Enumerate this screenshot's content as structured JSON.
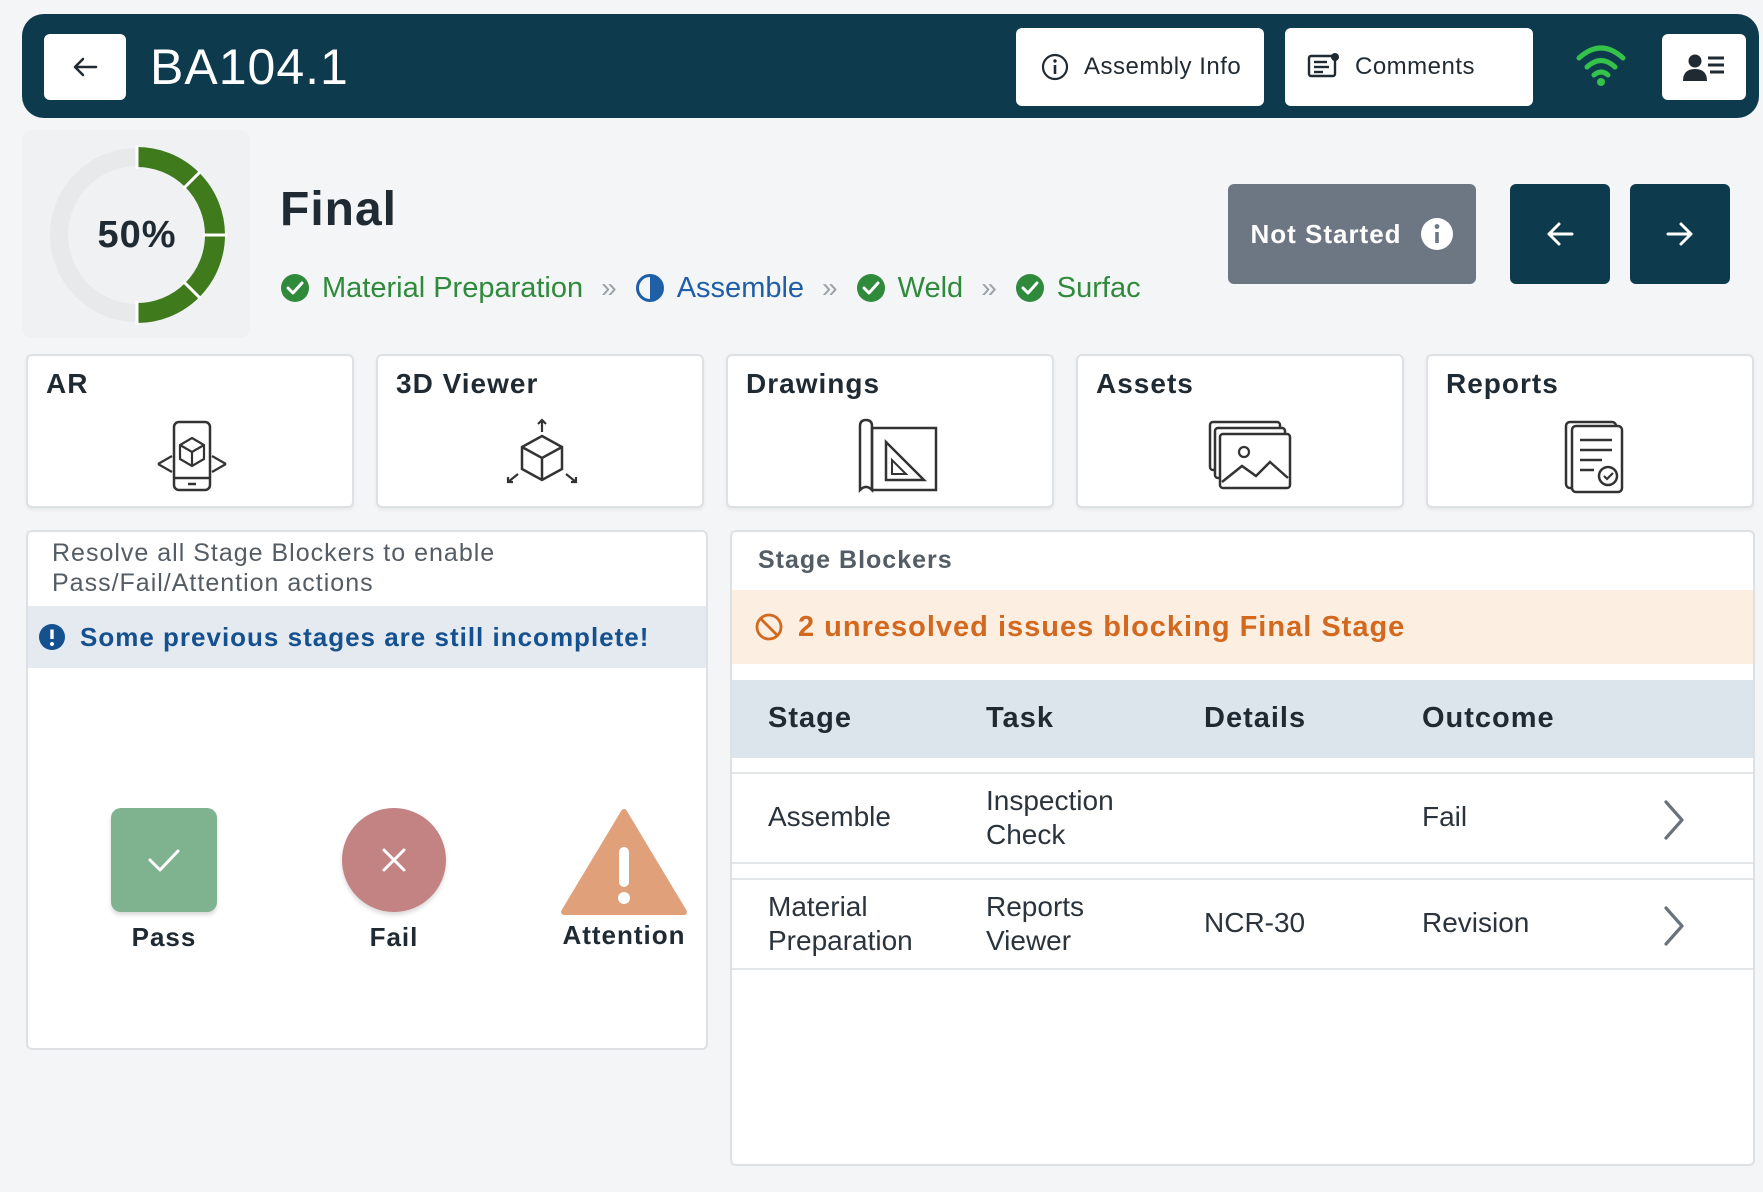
{
  "header": {
    "title": "BA104.1",
    "assembly_info_label": "Assembly Info",
    "comments_label": "Comments"
  },
  "progress": {
    "percent_label": "50%",
    "fraction": 0.5
  },
  "stage": {
    "title": "Final",
    "status": "Not Started",
    "breadcrumb": [
      {
        "label": "Material Preparation",
        "state": "complete"
      },
      {
        "label": "Assemble",
        "state": "in-progress"
      },
      {
        "label": "Weld",
        "state": "complete"
      },
      {
        "label": "Surfac",
        "state": "complete"
      }
    ]
  },
  "tools": [
    {
      "label": "AR",
      "icon": "ar-phone-icon"
    },
    {
      "label": "3D Viewer",
      "icon": "cube-icon"
    },
    {
      "label": "Drawings",
      "icon": "drawing-icon"
    },
    {
      "label": "Assets",
      "icon": "images-icon"
    },
    {
      "label": "Reports",
      "icon": "report-icon"
    }
  ],
  "actions": {
    "hint_line1": "Resolve all Stage Blockers to enable",
    "hint_line2": "Pass/Fail/Attention actions",
    "alert": "Some previous stages are still incomplete!",
    "pass_label": "Pass",
    "fail_label": "Fail",
    "attention_label": "Attention"
  },
  "blockers": {
    "title": "Stage Blockers",
    "alert": "2 unresolved issues blocking Final Stage",
    "columns": [
      "Stage",
      "Task",
      "Details",
      "Outcome"
    ],
    "rows": [
      {
        "stage_1": "Assemble",
        "stage_2": "",
        "task_1": "Inspection",
        "task_2": "Check",
        "details": "",
        "outcome": "Fail"
      },
      {
        "stage_1": "Material",
        "stage_2": "Preparation",
        "task_1": "Reports",
        "task_2": "Viewer",
        "details": "NCR-30",
        "outcome": "Revision"
      }
    ]
  },
  "colors": {
    "navbar": "#0d3a4d",
    "progress": "#3f7a1c",
    "status_badge": "#6d7683",
    "pass": "#7fb38f",
    "fail": "#c48383",
    "attention": "#e0a07a",
    "blocker_alert_text": "#d2691e"
  }
}
